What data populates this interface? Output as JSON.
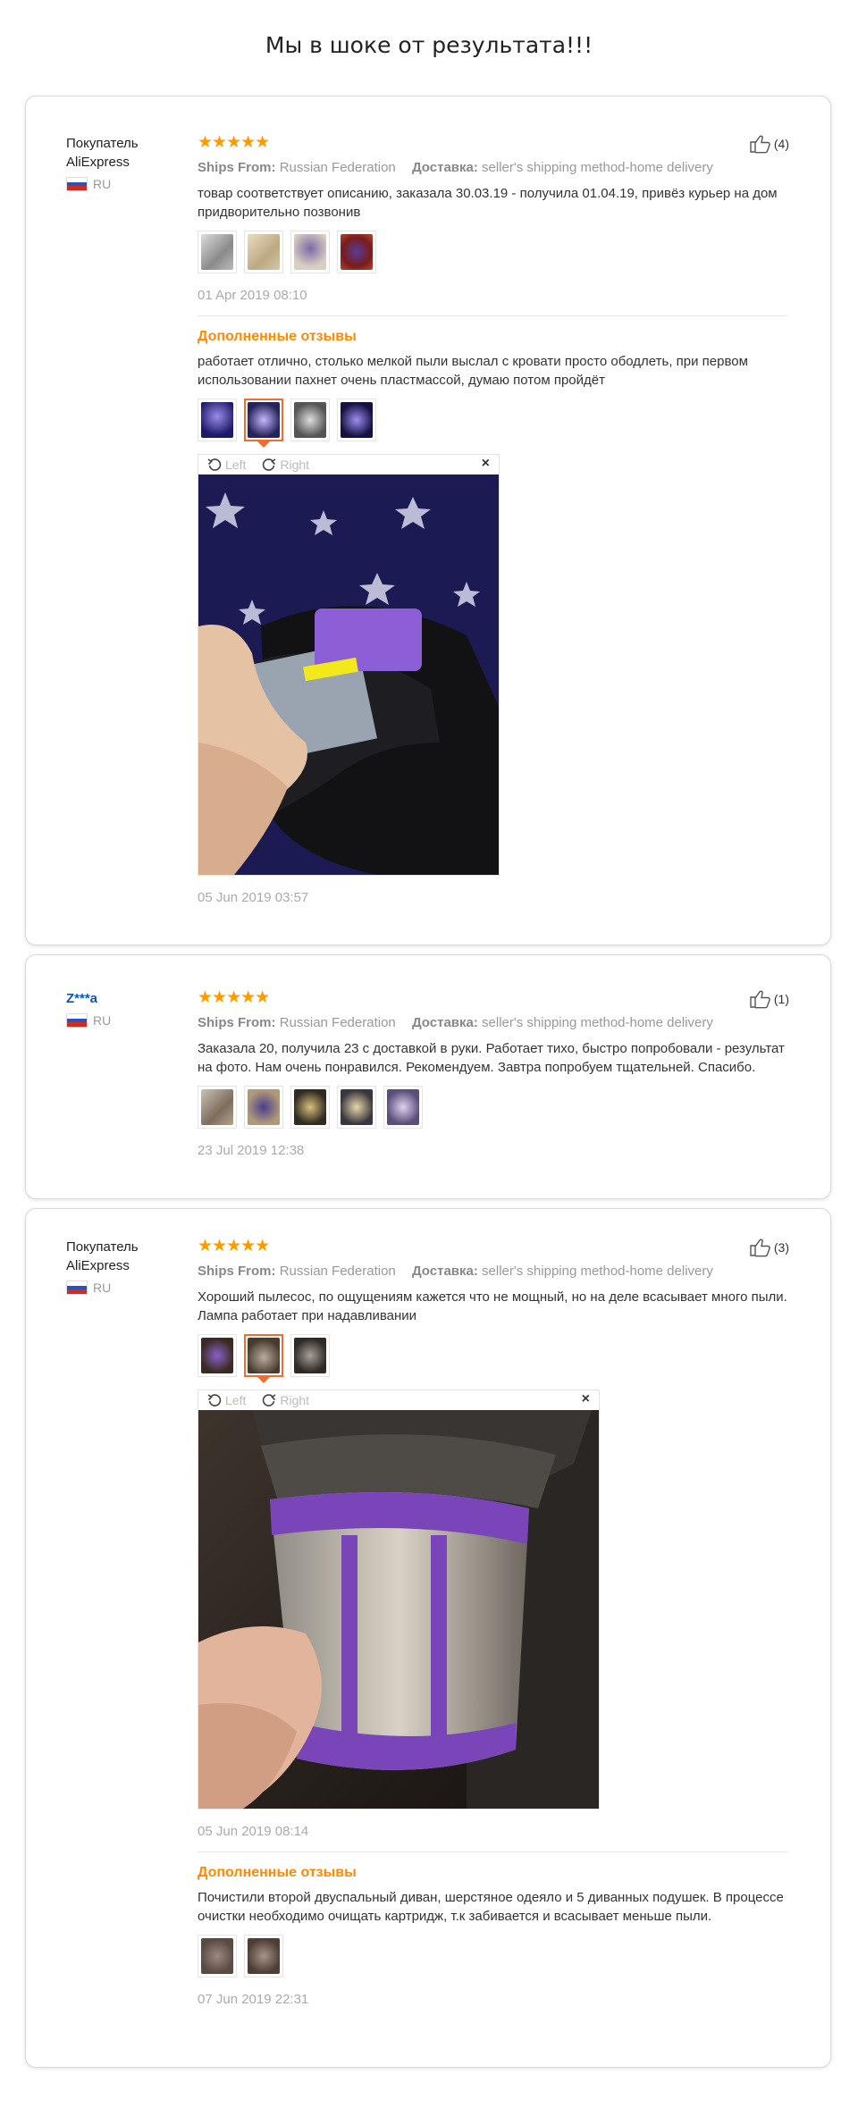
{
  "page_title": "Мы в шоке от результата!!!",
  "labels": {
    "ships_from": "Ships From:",
    "ships_value": "Russian Federation",
    "delivery": "Доставка:",
    "delivery_value": "seller's shipping method-home delivery",
    "additional": "Дополненные отзывы",
    "rotate_left": "Left",
    "rotate_right": "Right",
    "close": "×",
    "stars": "★★★★★"
  },
  "reviews": [
    {
      "user": "Покупатель AliExpress",
      "country": "RU",
      "likes": "(4)",
      "text": "товар соответствует описанию, заказала 30.03.19 - получила 01.04.19, привёз курьер на дом придворительно позвонив",
      "date": "01 Apr 2019 08:10",
      "additional_text": "работает отлично, столько мелкой пыли выслал с кровати просто ободлеть, при первом использовании пахнет очень пластмассой, думаю потом пройдёт",
      "additional_date": "05 Jun 2019 03:57"
    },
    {
      "user": "Z***a",
      "country": "RU",
      "likes": "(1)",
      "text": "Заказала 20, получила 23 с доставкой в руки. Работает тихо, быстро попробовали - результат на фото. Нам очень понравился. Рекомендуем. Завтра попробуем тщательней. Спасибо.",
      "date": "23 Jul 2019 12:38"
    },
    {
      "user": "Покупатель AliExpress",
      "country": "RU",
      "likes": "(3)",
      "text": "Хороший пылесос, по ощущениям кажется что не мощный, но на деле всасывает много пыли. Лампа работает при надавливании",
      "date": "05 Jun 2019 08:14",
      "additional_text": "Почистили второй двуспальный диван, шерстяное одеяло и 5 диванных подушек. В процессе очистки необходимо очищать картридж, т.к забивается и всасывает меньше пыли.",
      "additional_date": "07 Jun 2019 22:31"
    }
  ],
  "colors": {
    "accent_orange": "#ff8a00",
    "star": "#ff9a00",
    "link_blue": "#0b55b9",
    "active_thumb": "#f06d2c"
  }
}
